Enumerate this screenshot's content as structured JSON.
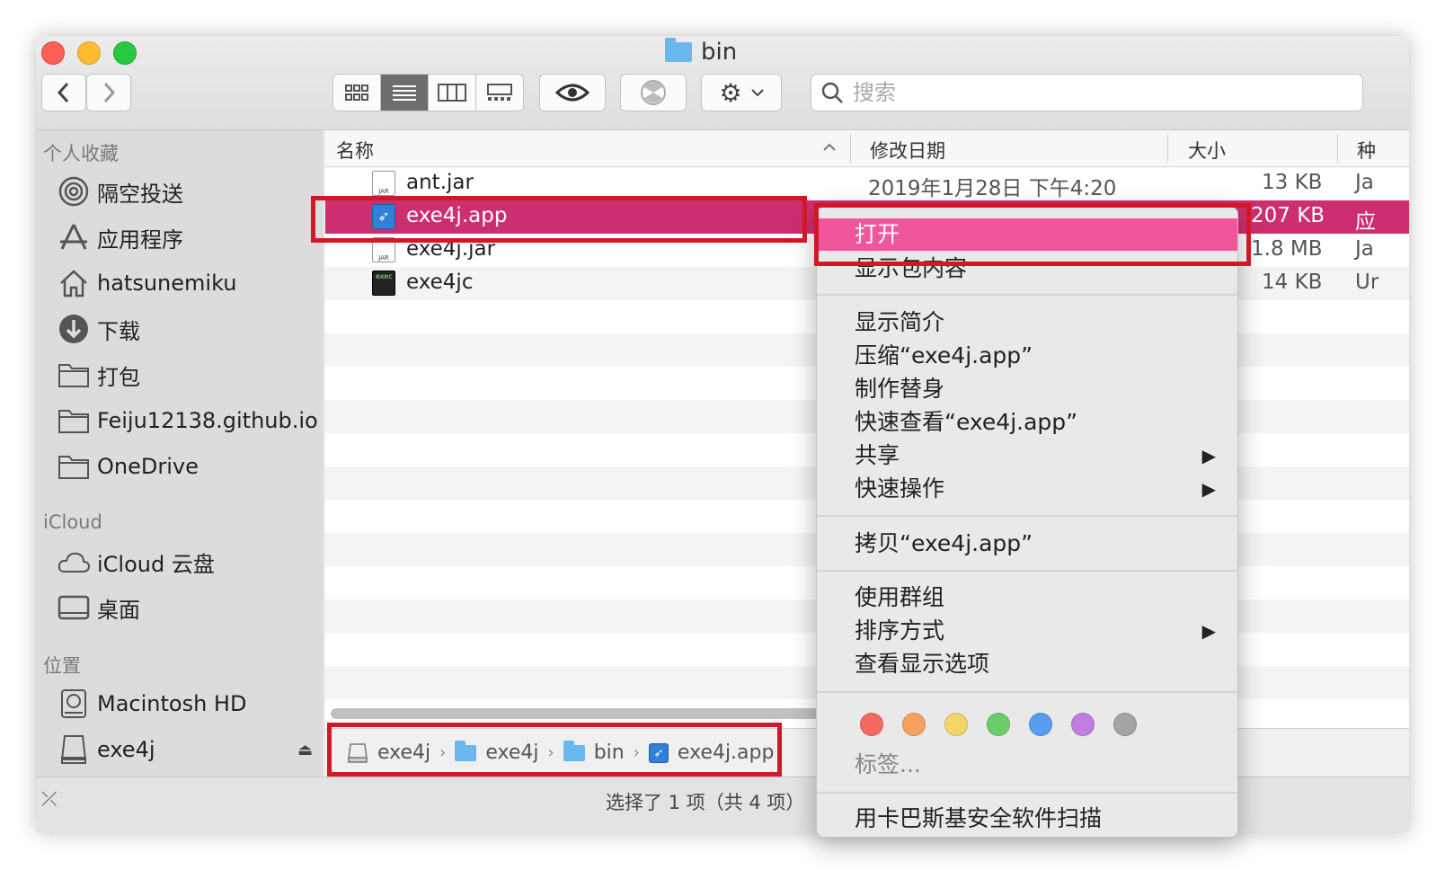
{
  "window": {
    "title": "bin"
  },
  "toolbar": {
    "search_placeholder": "搜索"
  },
  "sidebar": {
    "favorites_header": "个人收藏",
    "favorites": [
      {
        "label": "隔空投送",
        "icon": "airdrop-icon"
      },
      {
        "label": "应用程序",
        "icon": "applications-icon"
      },
      {
        "label": "hatsunemiku",
        "icon": "home-icon"
      },
      {
        "label": "下载",
        "icon": "downloads-icon"
      },
      {
        "label": "打包",
        "icon": "folder-icon"
      },
      {
        "label": "Feiju12138.github.io",
        "icon": "folder-icon"
      },
      {
        "label": "OneDrive",
        "icon": "folder-icon"
      }
    ],
    "icloud_header": "iCloud",
    "icloud": [
      {
        "label": "iCloud 云盘",
        "icon": "cloud-icon"
      },
      {
        "label": "桌面",
        "icon": "desktop-icon"
      }
    ],
    "locations_header": "位置",
    "locations": [
      {
        "label": "Macintosh HD",
        "icon": "hard-disk-icon"
      },
      {
        "label": "exe4j",
        "icon": "disk-icon"
      }
    ]
  },
  "columns": {
    "name": "名称",
    "date": "修改日期",
    "size": "大小",
    "kind": "种"
  },
  "files": [
    {
      "name": "ant.jar",
      "date": "2019年1月28日 下午4:20",
      "size": "13 KB",
      "kind": "Ja"
    },
    {
      "name": "exe4j.app",
      "date": "",
      "size": "207 KB",
      "kind": "应"
    },
    {
      "name": "exe4j.jar",
      "date": "",
      "size": "1.8 MB",
      "kind": "Ja"
    },
    {
      "name": "exe4jc",
      "date": "",
      "size": "14 KB",
      "kind": "Ur"
    }
  ],
  "pathbar": [
    "exe4j",
    "exe4j",
    "bin",
    "exe4j.app"
  ],
  "status": "选择了 1 项（共 4 项）",
  "context_menu": {
    "open": "打开",
    "show_package": "显示包内容",
    "get_info": "显示简介",
    "compress": "压缩“exe4j.app”",
    "make_alias": "制作替身",
    "quick_look": "快速查看“exe4j.app”",
    "share": "共享",
    "quick_actions": "快速操作",
    "copy": "拷贝“exe4j.app”",
    "use_groups": "使用群组",
    "sort_by": "排序方式",
    "view_options": "查看显示选项",
    "tags": "标签...",
    "tag_colors": [
      "#f46a5f",
      "#f5a25f",
      "#f5d469",
      "#6ccd6a",
      "#5a9cf0",
      "#c07ee0",
      "#a4a4a4"
    ],
    "last_item": "用卡巴斯基安全软件扫描"
  },
  "colors": {
    "selection": "#cc2e70",
    "menu_highlight": "#f0569c",
    "annotation": "#d01826"
  }
}
